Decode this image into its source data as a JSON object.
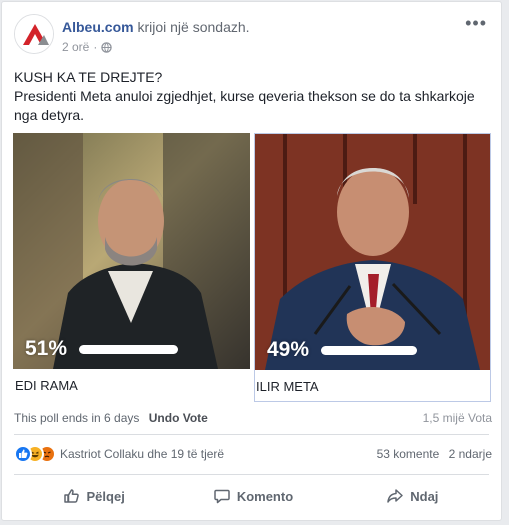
{
  "post": {
    "page_name": "Albeu.com",
    "action": "krijoi një sondazh.",
    "time": "2 orë",
    "title": "KUSH KA TE DREJTE?",
    "body": "Presidenti Meta anuloi zgjedhjet, kurse qeveria thekson se do ta shkarkoje nga detyra."
  },
  "poll": {
    "options": [
      {
        "label": "EDI RAMA",
        "percent": "51%",
        "value": 51
      },
      {
        "label": "ILIR META",
        "percent": "49%",
        "value": 49
      }
    ],
    "ends_text": "This poll ends in 6 days",
    "undo_label": "Undo Vote",
    "votes": "1,5 mijë Vota"
  },
  "reactions": {
    "names": "Kastriot Collaku dhe 19 të tjerë",
    "comments": "53 komente",
    "shares": "2 ndarje",
    "icons": [
      "like-reaction",
      "haha-reaction",
      "angry-reaction"
    ]
  },
  "actions": {
    "like": "Pëlqej",
    "comment": "Komento",
    "share": "Ndaj"
  },
  "colors": {
    "link": "#365899",
    "accent": "#1877f2"
  }
}
